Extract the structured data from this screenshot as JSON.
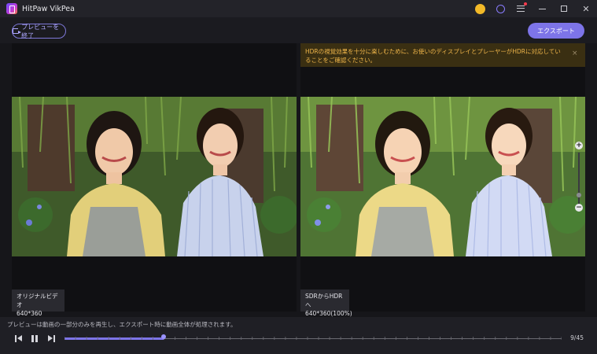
{
  "window": {
    "title": "HitPaw VikPea"
  },
  "titlebar_icons": [
    "cart-icon",
    "user-icon",
    "menu-icon",
    "minimize-icon",
    "maximize-icon",
    "close-icon"
  ],
  "toolbar": {
    "exit_preview_label": "プレビューを終了",
    "export_label": "エクスポート"
  },
  "notice": {
    "text": "HDRの視覚効果を十分に楽しむために、お使いのディスプレイとプレーヤーがHDRに対応していることをご確認ください。",
    "close": "×"
  },
  "left_panel": {
    "title": "オリジナルビデオ",
    "resolution": "640*360"
  },
  "right_panel": {
    "title": "SDRからHDRへ",
    "resolution": "640*360(100%)"
  },
  "zoom": {
    "in": "+",
    "out": "−",
    "level": 0.15
  },
  "bottom": {
    "hint": "プレビューは動画の一部分のみを再生し、エクスポート時に動画全体が処理されます。",
    "current_frame": 9,
    "total_frames": 45,
    "frame_label": "9/45"
  },
  "colors": {
    "accent": "#7d74e8",
    "notice_bg": "#3a2f12",
    "notice_text": "#f0b64a"
  }
}
